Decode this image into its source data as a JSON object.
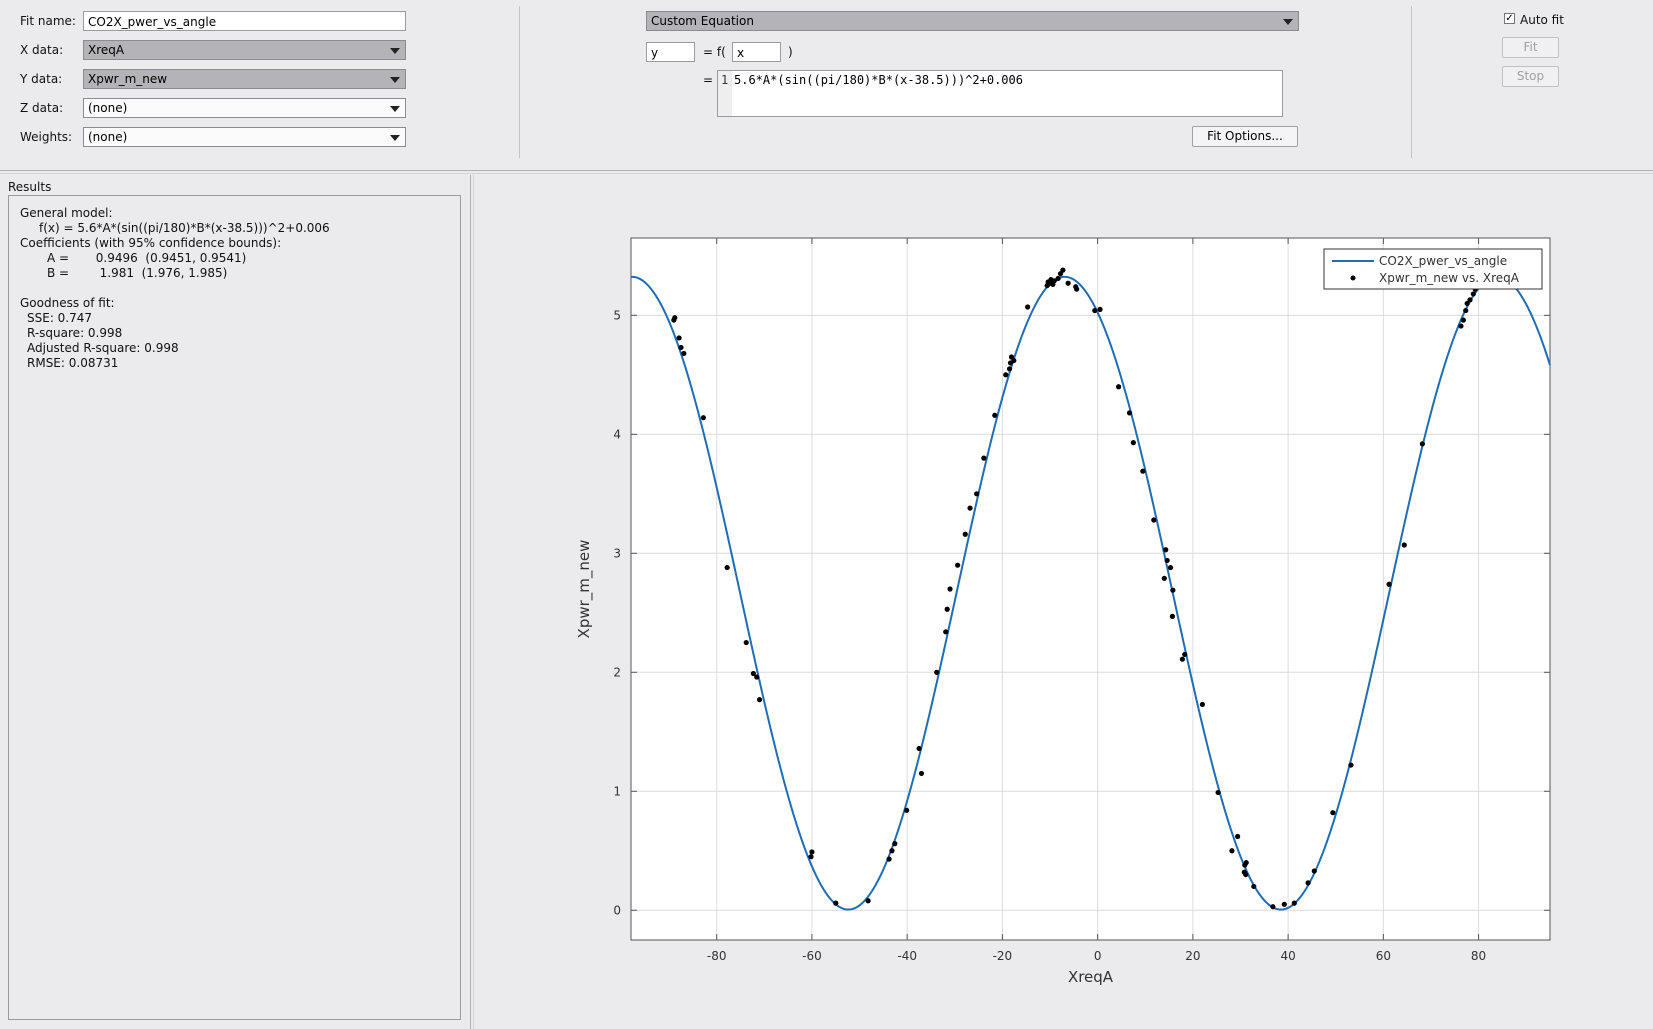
{
  "fit_panel": {
    "fit_name_label": "Fit name:",
    "fit_name_value": "CO2X_pwer_vs_angle",
    "x_data_label": "X data:",
    "x_data_value": "XreqA",
    "y_data_label": "Y data:",
    "y_data_value": "Xpwr_m_new",
    "z_data_label": "Z data:",
    "z_data_value": "(none)",
    "weights_label": "Weights:",
    "weights_value": "(none)"
  },
  "equation_panel": {
    "fit_type": "Custom Equation",
    "dependent_var": "y",
    "equals_f": "= f(",
    "independent_var": "x",
    "close_paren": ")",
    "equals": "=",
    "line_number": "1",
    "equation": "5.6*A*(sin((pi/180)*B*(x-38.5)))^2+0.006",
    "fit_options_label": "Fit Options..."
  },
  "right_panel": {
    "auto_fit_label": "Auto fit",
    "auto_fit_checked": true,
    "fit_label": "Fit",
    "stop_label": "Stop"
  },
  "results": {
    "title": "Results",
    "general_model": "General model:",
    "model_eq": "f(x) = 5.6*A*(sin((pi/180)*B*(x-38.5)))^2+0.006",
    "coeff_header": "Coefficients (with 95% confidence bounds):",
    "coeff_a": "A =       0.9496  (0.9451, 0.9541)",
    "coeff_b": "B =        1.981  (1.976, 1.985)",
    "gof_header": "Goodness of fit:",
    "sse": "SSE: 0.747",
    "rsquare": "R-square: 0.998",
    "adj_rsquare": "Adjusted R-square: 0.998",
    "rmse": "RMSE: 0.08731"
  },
  "chart_data": {
    "type": "scatter",
    "xlabel": "XreqA",
    "ylabel": "Xpwr_m_new",
    "xlim": [
      -98,
      95
    ],
    "ylim": [
      -0.25,
      5.65
    ],
    "xticks": [
      -80,
      -60,
      -40,
      -20,
      0,
      20,
      40,
      60,
      80
    ],
    "yticks": [
      0,
      1,
      2,
      3,
      4,
      5
    ],
    "grid": true,
    "legend_position": "top-right",
    "series": [
      {
        "name": "CO2X_pwer_vs_angle",
        "kind": "line",
        "color": "#1f6db5",
        "function": {
          "A": 0.9496,
          "B": 1.981,
          "amplitude": 5.6,
          "offset_x": 38.5,
          "offset_y": 0.006
        }
      },
      {
        "name": "Xpwr_m_new vs. XreqA",
        "kind": "points",
        "color": "#000000",
        "points": [
          [
            -89,
            4.96
          ],
          [
            -88.8,
            4.98
          ],
          [
            -87.9,
            4.81
          ],
          [
            -87.5,
            4.73
          ],
          [
            -86.9,
            4.68
          ],
          [
            -82.8,
            4.14
          ],
          [
            -77.8,
            2.88
          ],
          [
            -73.8,
            2.25
          ],
          [
            -72.3,
            1.99
          ],
          [
            -71.6,
            1.96
          ],
          [
            -71,
            1.77
          ],
          [
            -60.2,
            0.45
          ],
          [
            -60,
            0.49
          ],
          [
            -55,
            0.06
          ],
          [
            -48.2,
            0.08
          ],
          [
            -43.8,
            0.43
          ],
          [
            -43.2,
            0.5
          ],
          [
            -42.6,
            0.56
          ],
          [
            -40.1,
            0.84
          ],
          [
            -37.5,
            1.36
          ],
          [
            -37,
            1.15
          ],
          [
            -33.8,
            2.0
          ],
          [
            -31.9,
            2.34
          ],
          [
            -31.6,
            2.53
          ],
          [
            -31,
            2.7
          ],
          [
            -29.4,
            2.9
          ],
          [
            -27.8,
            3.16
          ],
          [
            -26.8,
            3.38
          ],
          [
            -25.4,
            3.5
          ],
          [
            -23.9,
            3.8
          ],
          [
            -21.6,
            4.16
          ],
          [
            -19.3,
            4.5
          ],
          [
            -18.5,
            4.55
          ],
          [
            -18.3,
            4.6
          ],
          [
            -18.1,
            4.65
          ],
          [
            -17.6,
            4.62
          ],
          [
            -14.7,
            5.07
          ],
          [
            -10.6,
            5.25
          ],
          [
            -10.4,
            5.28
          ],
          [
            -10,
            5.27
          ],
          [
            -9.8,
            5.3
          ],
          [
            -9.4,
            5.26
          ],
          [
            -9.1,
            5.29
          ],
          [
            -8.3,
            5.31
          ],
          [
            -7.8,
            5.35
          ],
          [
            -7.3,
            5.38
          ],
          [
            -6.2,
            5.27
          ],
          [
            -4.6,
            5.24
          ],
          [
            -4.4,
            5.22
          ],
          [
            -0.6,
            5.04
          ],
          [
            0.5,
            5.05
          ],
          [
            4.4,
            4.4
          ],
          [
            6.7,
            4.18
          ],
          [
            7.5,
            3.93
          ],
          [
            9.5,
            3.69
          ],
          [
            11.8,
            3.28
          ],
          [
            14.3,
            3.03
          ],
          [
            14.6,
            2.94
          ],
          [
            14,
            2.79
          ],
          [
            15.3,
            2.88
          ],
          [
            15.7,
            2.47
          ],
          [
            15.8,
            2.69
          ],
          [
            17.8,
            2.11
          ],
          [
            18.3,
            2.15
          ],
          [
            22,
            1.73
          ],
          [
            25.3,
            0.99
          ],
          [
            28.2,
            0.5
          ],
          [
            29.4,
            0.62
          ],
          [
            30.9,
            0.38
          ],
          [
            31.2,
            0.4
          ],
          [
            30.8,
            0.32
          ],
          [
            31.1,
            0.3
          ],
          [
            32.8,
            0.2
          ],
          [
            36.8,
            0.03
          ],
          [
            39.2,
            0.05
          ],
          [
            41.3,
            0.06
          ],
          [
            44.2,
            0.23
          ],
          [
            45.5,
            0.33
          ],
          [
            49.4,
            0.82
          ],
          [
            53.2,
            1.22
          ],
          [
            61.2,
            2.74
          ],
          [
            64.4,
            3.07
          ],
          [
            68.2,
            3.92
          ],
          [
            76.3,
            4.91
          ],
          [
            76.8,
            4.96
          ],
          [
            77.3,
            5.04
          ],
          [
            77.6,
            5.1
          ],
          [
            78.2,
            5.13
          ],
          [
            78.9,
            5.18
          ],
          [
            79.3,
            5.22
          ]
        ]
      }
    ]
  }
}
